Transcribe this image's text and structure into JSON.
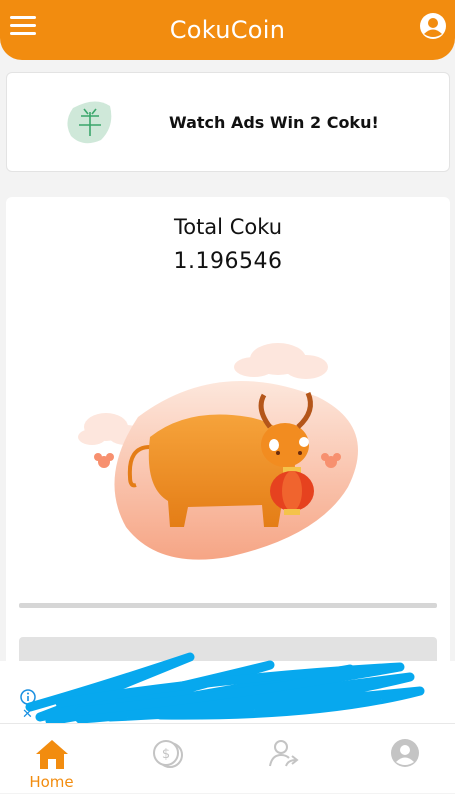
{
  "header": {
    "title": "CokuCoin"
  },
  "ad_card": {
    "label": "Watch Ads Win 2 Coku!"
  },
  "balance": {
    "label": "Total Coku",
    "value": "1.196546"
  },
  "bottom_nav": {
    "items": [
      {
        "label": "Home",
        "icon": "home-icon",
        "active": true
      },
      {
        "label": "",
        "icon": "coins-icon",
        "active": false
      },
      {
        "label": "",
        "icon": "share-user-icon",
        "active": false
      },
      {
        "label": "",
        "icon": "account-icon",
        "active": false
      }
    ]
  },
  "colors": {
    "brand": "#f28c0f",
    "inactive_icon": "#c4c4c4",
    "scribble": "#07a8ee"
  }
}
